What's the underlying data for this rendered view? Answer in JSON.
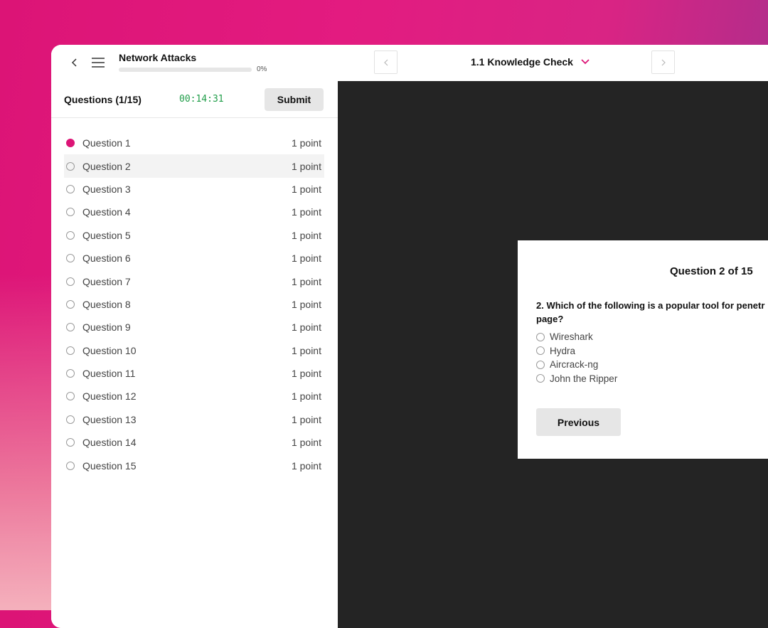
{
  "header": {
    "course_title": "Network Attacks",
    "progress": 0,
    "progress_label": "0%",
    "section_title": "1.1 Knowledge Check"
  },
  "sidebar": {
    "question_count": "Questions (1/15)",
    "timer": "00:14:31",
    "submit_label": "Submit",
    "questions": [
      {
        "label": "Question 1",
        "points": "1 point"
      },
      {
        "label": "Question 2",
        "points": "1 point"
      },
      {
        "label": "Question 3",
        "points": "1 point"
      },
      {
        "label": "Question 4",
        "points": "1 point"
      },
      {
        "label": "Question 5",
        "points": "1 point"
      },
      {
        "label": "Question 6",
        "points": "1 point"
      },
      {
        "label": "Question 7",
        "points": "1 point"
      },
      {
        "label": "Question 8",
        "points": "1 point"
      },
      {
        "label": "Question 9",
        "points": "1 point"
      },
      {
        "label": "Question 10",
        "points": "1 point"
      },
      {
        "label": "Question 11",
        "points": "1 point"
      },
      {
        "label": "Question 12",
        "points": "1 point"
      },
      {
        "label": "Question 13",
        "points": "1 point"
      },
      {
        "label": "Question 14",
        "points": "1 point"
      },
      {
        "label": "Question 15",
        "points": "1 point"
      }
    ]
  },
  "card": {
    "title": "Question 2 of 15",
    "question": "2. Which of the following is a popular tool for penetr page?",
    "options": [
      "Wireshark",
      "Hydra",
      "Aircrack-ng",
      "John the Ripper"
    ],
    "previous_label": "Previous"
  },
  "colors": {
    "accent": "#dc1476",
    "timer": "#1f9d48",
    "content_bg": "#242424"
  }
}
